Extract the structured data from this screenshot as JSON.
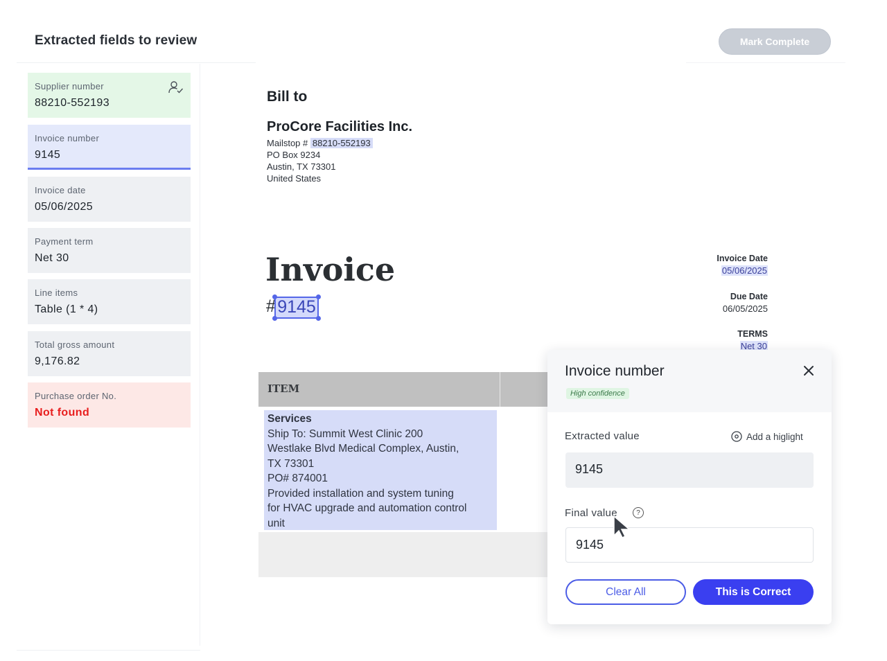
{
  "header": {
    "title": "Extracted fields to review",
    "mark_complete_label": "Mark Complete"
  },
  "fields": [
    {
      "label": "Supplier number",
      "value": "88210-552193",
      "status": "verified"
    },
    {
      "label": "Invoice number",
      "value": "9145",
      "status": "selected"
    },
    {
      "label": "Invoice date",
      "value": "05/06/2025",
      "status": "default"
    },
    {
      "label": "Payment term",
      "value": "Net 30",
      "status": "default"
    },
    {
      "label": "Line items",
      "value": "Table (1 * 4)",
      "status": "default"
    },
    {
      "label": "Total gross amount",
      "value": "9,176.82",
      "status": "default"
    },
    {
      "label": "Purchase order No.",
      "value": "Not found",
      "status": "missing"
    }
  ],
  "document": {
    "bill_to_heading": "Bill to",
    "company": "ProCore Facilities Inc.",
    "mailstop_prefix": "Mailstop #",
    "mailstop_value": "88210-552193",
    "address_line2": "PO Box 9234",
    "address_line3": "Austin, TX 73301",
    "address_line4": "United States",
    "invoice_heading": "Invoice",
    "invoice_hash": "#",
    "invoice_number": "9145",
    "meta": {
      "invoice_date_label": "Invoice Date",
      "invoice_date_value": "05/06/2025",
      "due_date_label": "Due Date",
      "due_date_value": "06/05/2025",
      "terms_label": "TERMS",
      "terms_value": "Net 30"
    },
    "table": {
      "header": "ITEM",
      "cell_title": "Services",
      "cell_lines": [
        "Ship To: Summit West Clinic 200",
        "Westlake Blvd Medical Complex, Austin,",
        "TX 73301",
        "PO# 874001",
        "Provided installation and system tuning",
        "for HVAC upgrade and automation control",
        "unit"
      ]
    }
  },
  "popover": {
    "title": "Invoice number",
    "confidence": "High confidence",
    "extracted_label": "Extracted value",
    "add_highlight_label": "Add a higlight",
    "extracted_value": "9145",
    "final_label": "Final value",
    "final_value": "9145",
    "clear_label": "Clear All",
    "correct_label": "This is Correct"
  },
  "colors": {
    "accent": "#3a3ff0",
    "verified_bg": "#e4f7e7",
    "selected_bg": "#e4e9fb",
    "missing_bg": "#fde8e6",
    "missing_text": "#e81e1e",
    "highlight": "#d6dcf8"
  },
  "icons": [
    "user-check-icon",
    "close-icon",
    "add-highlight-icon",
    "help-icon",
    "cursor-icon"
  ]
}
